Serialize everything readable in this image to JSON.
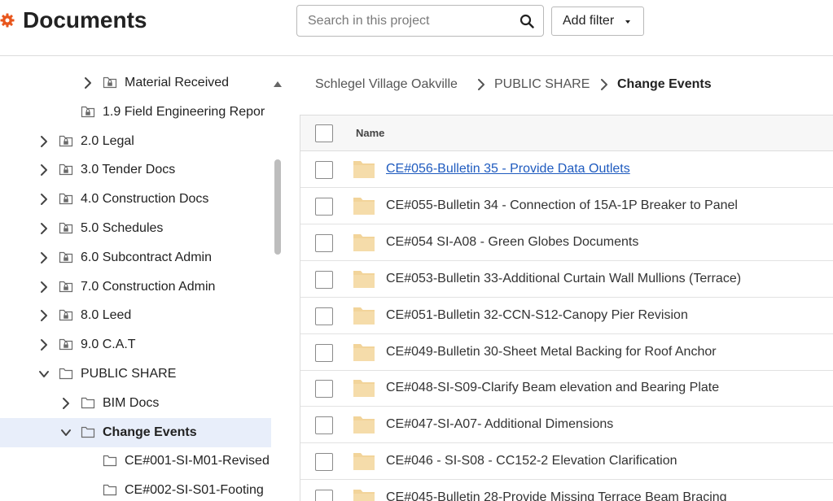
{
  "header": {
    "title": "Documents",
    "search_placeholder": "Search in this project",
    "add_filter_label": "Add filter"
  },
  "sidebar": {
    "items": [
      {
        "label": "Material Received",
        "kind": "locked-folder",
        "chevron": "right"
      },
      {
        "label": "1.9 Field Engineering Repor",
        "kind": "locked-folder",
        "chevron": "none"
      },
      {
        "label": "2.0 Legal",
        "kind": "locked-folder",
        "chevron": "right"
      },
      {
        "label": "3.0 Tender Docs",
        "kind": "locked-folder",
        "chevron": "right"
      },
      {
        "label": "4.0 Construction Docs",
        "kind": "locked-folder",
        "chevron": "right"
      },
      {
        "label": "5.0 Schedules",
        "kind": "locked-folder",
        "chevron": "right"
      },
      {
        "label": "6.0 Subcontract Admin",
        "kind": "locked-folder",
        "chevron": "right"
      },
      {
        "label": "7.0 Construction Admin",
        "kind": "locked-folder",
        "chevron": "right"
      },
      {
        "label": "8.0 Leed",
        "kind": "locked-folder",
        "chevron": "right"
      },
      {
        "label": "9.0 C.A.T",
        "kind": "locked-folder",
        "chevron": "right"
      },
      {
        "label": "PUBLIC SHARE",
        "kind": "folder",
        "chevron": "down"
      },
      {
        "label": "BIM Docs",
        "kind": "folder",
        "chevron": "right"
      },
      {
        "label": "Change Events",
        "kind": "folder",
        "chevron": "down",
        "selected": true
      },
      {
        "label": "CE#001-SI-M01-Revised",
        "kind": "folder",
        "chevron": "none"
      },
      {
        "label": "CE#002-SI-S01-Footing",
        "kind": "folder",
        "chevron": "none"
      }
    ]
  },
  "breadcrumb": {
    "items": [
      "Schlegel Village Oakville",
      "PUBLIC SHARE",
      "Change Events"
    ]
  },
  "table": {
    "header_name": "Name",
    "rows": [
      {
        "name": "CE#056-Bulletin 35 - Provide Data Outlets",
        "hover": true
      },
      {
        "name": "CE#055-Bulletin 34 - Connection of 15A-1P Breaker to Panel"
      },
      {
        "name": "CE#054 SI-A08 - Green Globes Documents"
      },
      {
        "name": "CE#053-Bulletin 33-Additional Curtain Wall Mullions (Terrace)"
      },
      {
        "name": "CE#051-Bulletin 32-CCN-S12-Canopy Pier Revision"
      },
      {
        "name": "CE#049-Bulletin 30-Sheet Metal Backing for Roof Anchor"
      },
      {
        "name": "CE#048-SI-S09-Clarify Beam elevation and Bearing Plate"
      },
      {
        "name": "CE#047-SI-A07- Additional Dimensions"
      },
      {
        "name": "CE#046 - SI-S08 - CC152-2 Elevation Clarification"
      },
      {
        "name": "CE#045-Bulletin 28-Provide Missing Terrace Beam Bracing"
      }
    ]
  },
  "colors": {
    "accent": "#e8561c",
    "link": "#1f5bbf",
    "folder": "#f2d49a",
    "selected_row": "#e8eefa"
  }
}
